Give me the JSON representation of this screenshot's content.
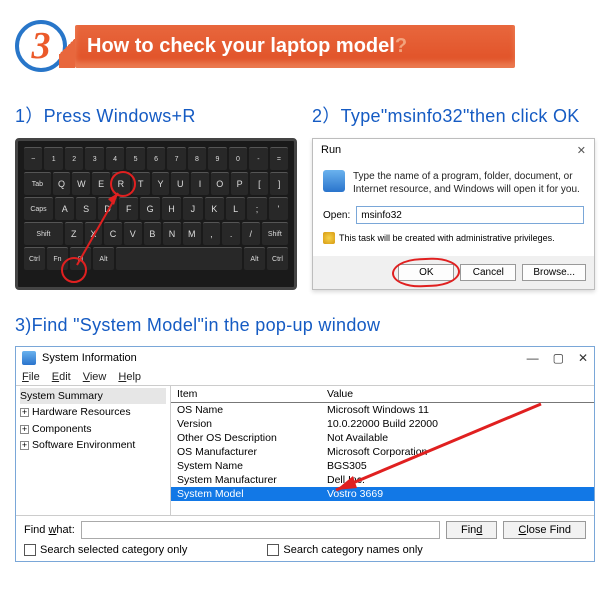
{
  "badge": {
    "number": "3"
  },
  "banner": {
    "text": "How to check your laptop model",
    "suffix": "?"
  },
  "steps": {
    "s1": {
      "title": "1）Press Windows+R"
    },
    "s2": {
      "title": "2）Type\"msinfo32\"then click OK"
    },
    "s3": {
      "title": "3)Find \"System Model\"in the pop-up window"
    }
  },
  "keyboard": {
    "row1": [
      "~",
      "1",
      "2",
      "3",
      "4",
      "5",
      "6",
      "7",
      "8",
      "9",
      "0",
      "-",
      "="
    ],
    "row2": [
      "Tab",
      "Q",
      "W",
      "E",
      "R",
      "T",
      "Y",
      "U",
      "I",
      "O",
      "P",
      "[",
      "]"
    ],
    "row3": [
      "Caps",
      "A",
      "S",
      "D",
      "F",
      "G",
      "H",
      "J",
      "K",
      "L",
      ";",
      "'"
    ],
    "row4": [
      "Shift",
      "Z",
      "X",
      "C",
      "V",
      "B",
      "N",
      "M",
      ",",
      ".",
      "/",
      "Shift"
    ],
    "row5": [
      "Ctrl",
      "Fn",
      "⊞",
      "Alt",
      "",
      "Alt",
      "Ctrl",
      "◄",
      "▲",
      "►"
    ]
  },
  "run": {
    "title": "Run",
    "close": "✕",
    "desc": "Type the name of a program, folder, document, or Internet resource, and Windows will open it for you.",
    "open_label": "Open:",
    "input_value": "msinfo32",
    "priv_text": "This task will be created with administrative privileges.",
    "ok": "OK",
    "cancel": "Cancel",
    "browse": "Browse..."
  },
  "sysinfo": {
    "title": "System Information",
    "min": "—",
    "max": "▢",
    "close": "✕",
    "menu": {
      "file": "File",
      "edit": "Edit",
      "view": "View",
      "help": "Help"
    },
    "tree": [
      {
        "label": "System Summary",
        "expandable": false,
        "selected": true
      },
      {
        "label": "Hardware Resources",
        "expandable": true
      },
      {
        "label": "Components",
        "expandable": true
      },
      {
        "label": "Software Environment",
        "expandable": true
      }
    ],
    "cols": {
      "c1": "Item",
      "c2": "Value"
    },
    "rows": [
      {
        "item": "OS Name",
        "value": "Microsoft Windows 11"
      },
      {
        "item": "Version",
        "value": "10.0.22000 Build 22000"
      },
      {
        "item": "Other OS Description",
        "value": "Not Available"
      },
      {
        "item": "OS Manufacturer",
        "value": "Microsoft Corporation"
      },
      {
        "item": "System Name",
        "value": "BGS305"
      },
      {
        "item": "System Manufacturer",
        "value": "Dell Inc."
      },
      {
        "item": "System Model",
        "value": "Vostro 3669",
        "hl": true
      }
    ],
    "find": {
      "label": "Find what:",
      "find_btn": "Find",
      "close_btn": "Close Find",
      "check1": "Search selected category only",
      "check2": "Search category names only"
    }
  }
}
